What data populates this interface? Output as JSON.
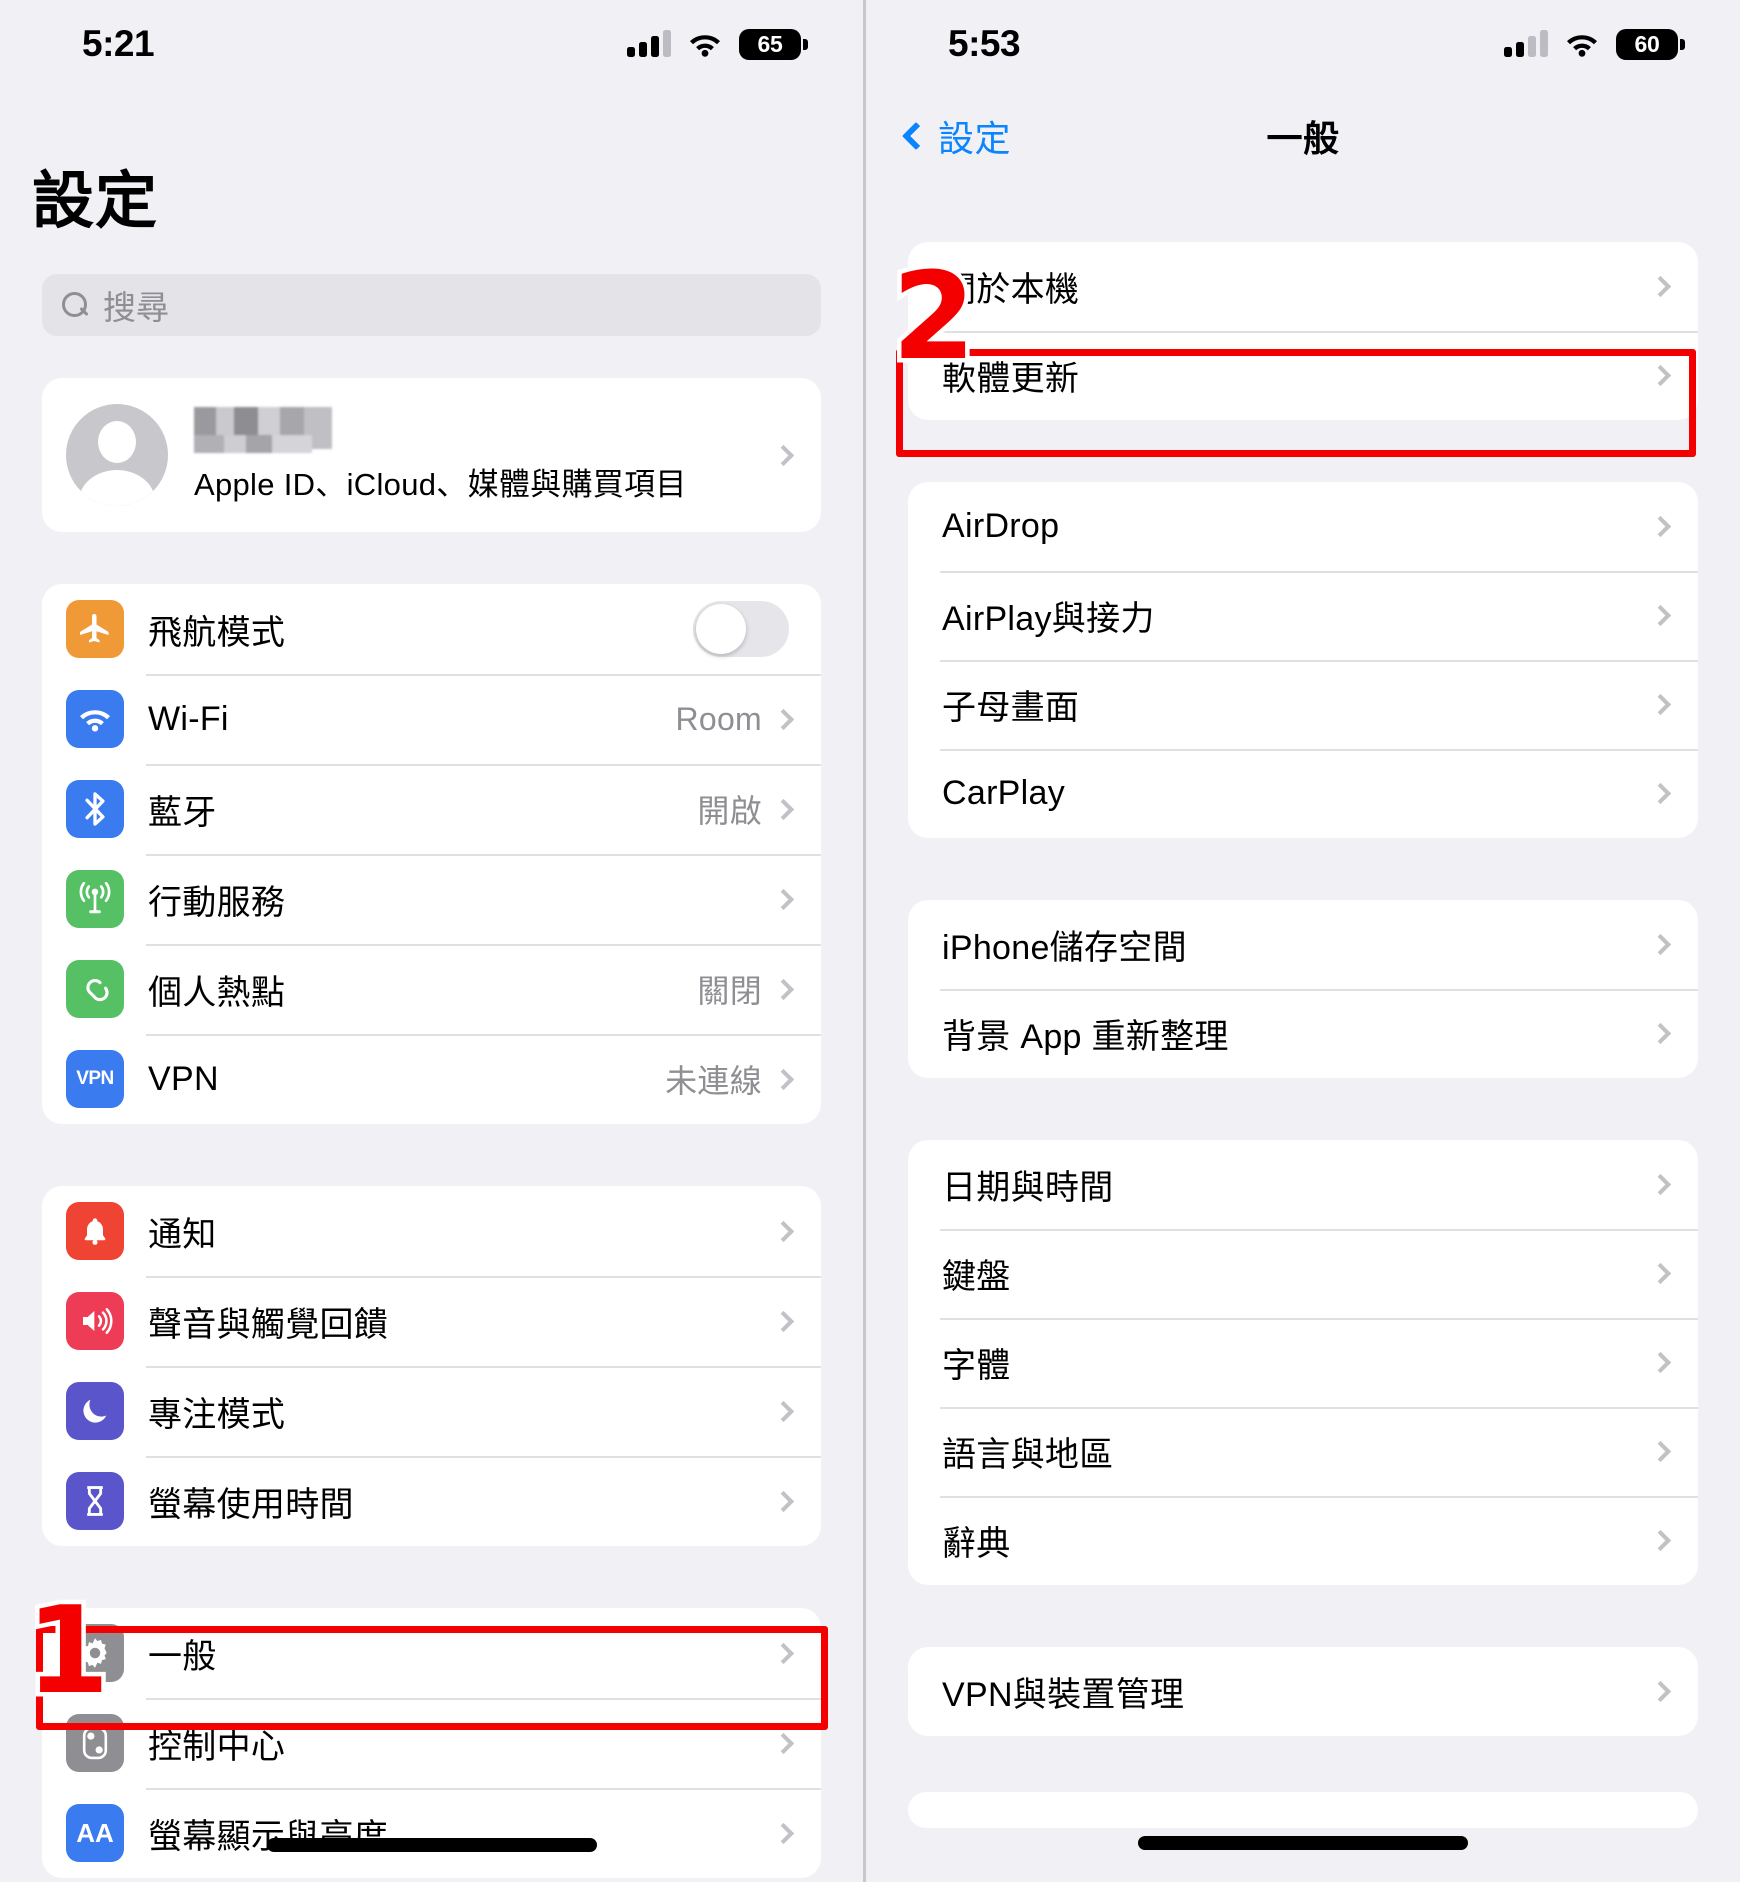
{
  "left_phone": {
    "status_bar": {
      "time": "5:21",
      "signal_bars": 3,
      "signal_total": 4,
      "wifi": "wifi-icon",
      "battery_percent": "65"
    },
    "page_title": "設定",
    "search": {
      "placeholder": "搜尋",
      "icon": "search-icon"
    },
    "account": {
      "name_redacted": "",
      "subtitle": "Apple ID、iCloud、媒體與購買項目"
    },
    "groups": [
      {
        "rows": [
          {
            "icon": "airplane-icon",
            "color": "#f09a37",
            "label": "飛航模式",
            "control": "toggle",
            "toggle_on": false
          },
          {
            "icon": "wifi-icon",
            "color": "#3a7bf0",
            "label": "Wi-Fi",
            "value": "Room",
            "control": "chevron"
          },
          {
            "icon": "bluetooth-icon",
            "color": "#3a7bf0",
            "label": "藍牙",
            "value": "開啟",
            "control": "chevron"
          },
          {
            "icon": "cellular-icon",
            "color": "#56c164",
            "label": "行動服務",
            "value": "",
            "control": "chevron"
          },
          {
            "icon": "hotspot-icon",
            "color": "#56c164",
            "label": "個人熱點",
            "value": "關閉",
            "control": "chevron"
          },
          {
            "icon": "vpn-icon",
            "color": "#3a7bf0",
            "label": "VPN",
            "value": "未連線",
            "control": "chevron"
          }
        ]
      },
      {
        "rows": [
          {
            "icon": "bell-icon",
            "color": "#ef4434",
            "label": "通知",
            "value": "",
            "control": "chevron"
          },
          {
            "icon": "speaker-icon",
            "color": "#ee3c56",
            "label": "聲音與觸覺回饋",
            "value": "",
            "control": "chevron"
          },
          {
            "icon": "moon-icon",
            "color": "#5a55ca",
            "label": "專注模式",
            "value": "",
            "control": "chevron"
          },
          {
            "icon": "hourglass-icon",
            "color": "#5a55ca",
            "label": "螢幕使用時間",
            "value": "",
            "control": "chevron"
          }
        ]
      },
      {
        "rows": [
          {
            "icon": "gear-icon",
            "color": "#8e8e93",
            "label": "一般",
            "value": "",
            "control": "chevron",
            "highlighted": true
          },
          {
            "icon": "control-center-icon",
            "color": "#8e8e93",
            "label": "控制中心",
            "value": "",
            "control": "chevron"
          },
          {
            "icon": "display-aa-icon",
            "color": "#3a7bf0",
            "label": "螢幕顯示與亮度",
            "value": "",
            "control": "chevron"
          }
        ]
      }
    ],
    "annotation": {
      "number": "1",
      "target": "一般"
    }
  },
  "right_phone": {
    "status_bar": {
      "time": "5:53",
      "signal_bars": 2,
      "signal_total": 4,
      "wifi": "wifi-icon",
      "battery_percent": "60"
    },
    "nav": {
      "back_label": "設定",
      "back_icon": "chevron-left-icon",
      "title": "一般"
    },
    "groups": [
      {
        "rows": [
          {
            "label": "關於本機",
            "control": "chevron"
          },
          {
            "label": "軟體更新",
            "control": "chevron",
            "highlighted": true
          }
        ]
      },
      {
        "rows": [
          {
            "label": "AirDrop",
            "control": "chevron"
          },
          {
            "label": "AirPlay與接力",
            "control": "chevron"
          },
          {
            "label": "子母畫面",
            "control": "chevron"
          },
          {
            "label": "CarPlay",
            "control": "chevron"
          }
        ]
      },
      {
        "rows": [
          {
            "label": "iPhone儲存空間",
            "control": "chevron"
          },
          {
            "label": "背景 App 重新整理",
            "control": "chevron"
          }
        ]
      },
      {
        "rows": [
          {
            "label": "日期與時間",
            "control": "chevron"
          },
          {
            "label": "鍵盤",
            "control": "chevron"
          },
          {
            "label": "字體",
            "control": "chevron"
          },
          {
            "label": "語言與地區",
            "control": "chevron"
          },
          {
            "label": "辭典",
            "control": "chevron"
          }
        ]
      },
      {
        "rows": [
          {
            "label": "VPN與裝置管理",
            "control": "chevron"
          }
        ]
      }
    ],
    "annotation": {
      "number": "2",
      "target": "軟體更新"
    }
  },
  "colors": {
    "annotation_red": "#f40000",
    "accent_blue": "#0a84ff",
    "value_gray": "#8e8e93"
  }
}
